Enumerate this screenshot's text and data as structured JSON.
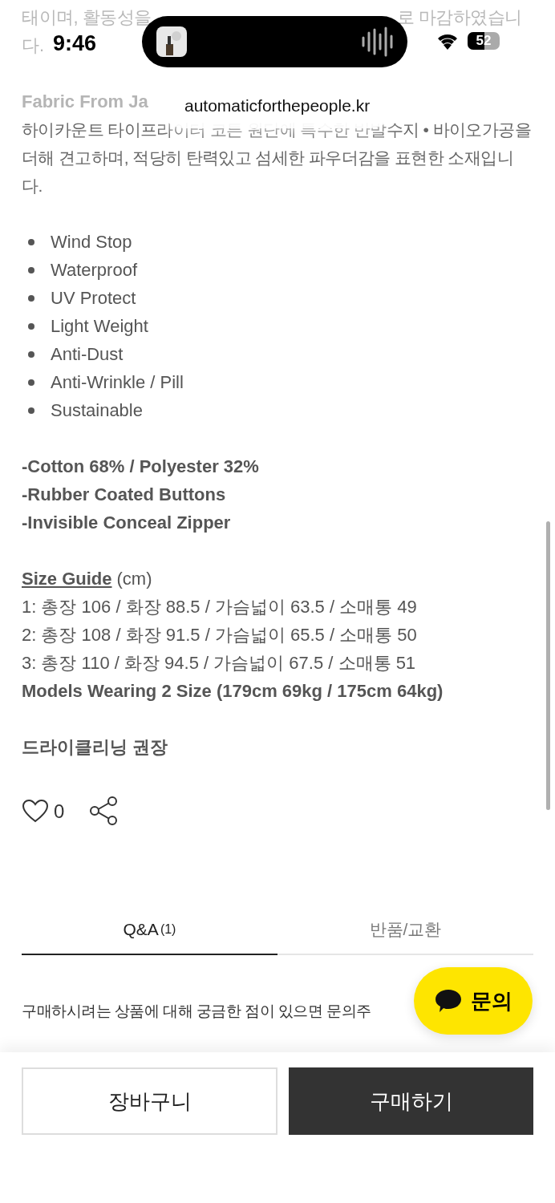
{
  "status_bar": {
    "time": "9:46",
    "battery": "52"
  },
  "address_bar": {
    "url": "automaticforthepeople.kr"
  },
  "description": {
    "intro_text": [
      "태이며, 활동성을",
      "로 마감하였습니",
      "다."
    ],
    "fabric_title": "Fabric From Ja",
    "fabric_text": "하이카운트 타이프라이터 코튼 원단에 특수한 반발수지 • 바이오가공을 더해 견고하며, 적당히 탄력있고 섬세한 파우더감을 표현한 소재입니다.",
    "features": [
      "Wind Stop",
      "Waterproof",
      "UV Protect",
      "Light Weight",
      "Anti-Dust",
      "Anti-Wrinkle / Pill",
      "Sustainable"
    ],
    "composition": [
      "-Cotton 68% / Polyester 32%",
      "-Rubber Coated Buttons",
      "-Invisible Conceal Zipper"
    ],
    "size_guide": {
      "title": "Size Guide",
      "unit": "(cm)",
      "rows": [
        "1: 총장 106 / 화장 88.5 / 가슴넓이 63.5 / 소매통 49",
        "2: 총장 108 / 화장 91.5 / 가슴넓이 65.5 / 소매통 50",
        "3: 총장 110 / 화장 94.5 / 가슴넓이 67.5 / 소매통 51"
      ],
      "models_note": "Models Wearing 2 Size (179cm 69kg / 175cm 64kg)"
    },
    "care_note": "드라이클리닝 권장"
  },
  "actions": {
    "like_count": "0"
  },
  "tabs": [
    {
      "label": "Q&A",
      "count": "(1)",
      "selected": true
    },
    {
      "label": "반품/교환",
      "selected": false
    }
  ],
  "qa_prompt": "구매하시려는 상품에 대해 궁금한 점이 있으면 문의주",
  "chat_button": {
    "label": "문의"
  },
  "bottom_buttons": [
    {
      "label": "장바구니",
      "kind": "outline"
    },
    {
      "label": "구매하기",
      "kind": "primary"
    }
  ]
}
